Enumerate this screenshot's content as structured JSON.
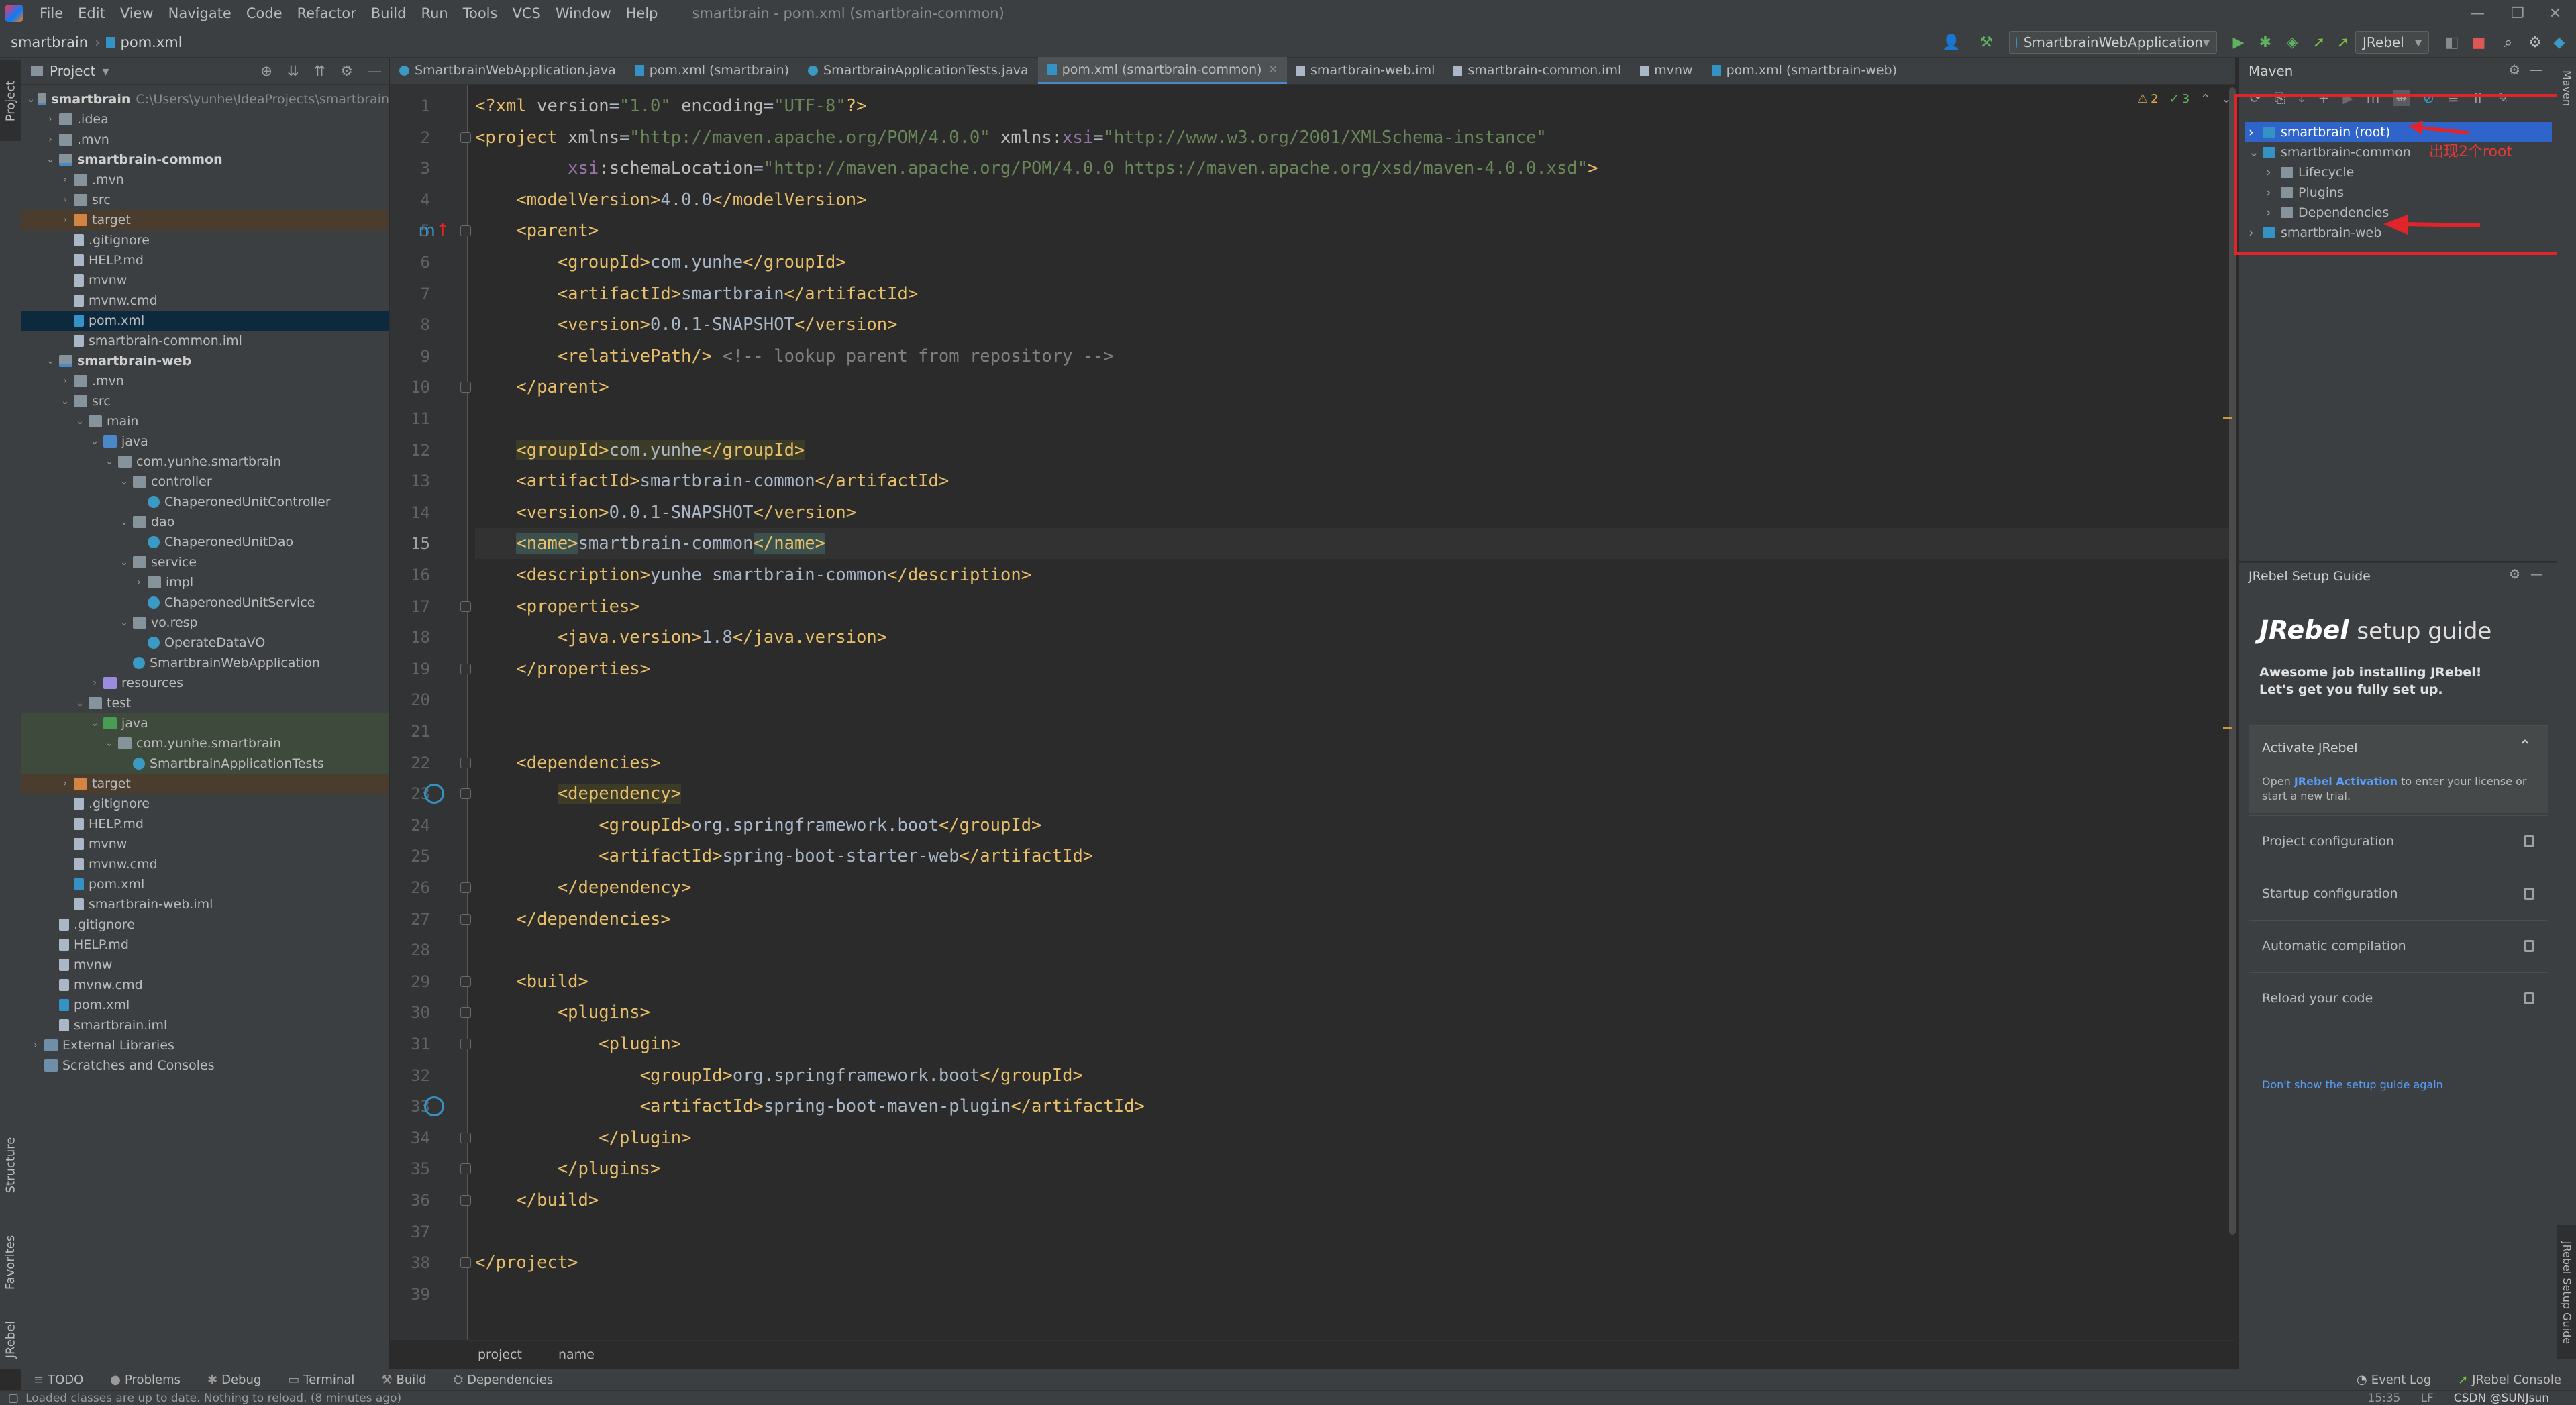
{
  "menu": {
    "items": [
      "File",
      "Edit",
      "View",
      "Navigate",
      "Code",
      "Refactor",
      "Build",
      "Run",
      "Tools",
      "VCS",
      "Window",
      "Help"
    ],
    "window_title": "smartbrain - pom.xml (smartbrain-common)"
  },
  "navbar": {
    "project": "smartbrain",
    "file": "pom.xml",
    "run_config": "SmartbrainWebApplication",
    "jrebel_label": "JRebel"
  },
  "left_strip": {
    "project": "Project",
    "structure": "Structure",
    "favorites": "Favorites",
    "jrebel": "JRebel"
  },
  "project_panel": {
    "title": "Project",
    "tree": [
      {
        "label": "smartbrain",
        "sub": "C:\\Users\\yunhe\\IdeaProjects\\smartbrain",
        "depth": 0,
        "arrow": "v",
        "icon": "folder-module",
        "style": "bold"
      },
      {
        "label": ".idea",
        "depth": 1,
        "arrow": ">",
        "icon": "folder"
      },
      {
        "label": ".mvn",
        "depth": 1,
        "arrow": ">",
        "icon": "folder"
      },
      {
        "label": "smartbrain-common",
        "depth": 1,
        "arrow": "v",
        "icon": "folder-module",
        "style": "bold"
      },
      {
        "label": ".mvn",
        "depth": 2,
        "arrow": ">",
        "icon": "folder"
      },
      {
        "label": "src",
        "depth": 2,
        "arrow": ">",
        "icon": "folder"
      },
      {
        "label": "target",
        "depth": 2,
        "arrow": ">",
        "icon": "folder-excl",
        "style": "excluded"
      },
      {
        "label": ".gitignore",
        "depth": 2,
        "arrow": "",
        "icon": "file"
      },
      {
        "label": "HELP.md",
        "depth": 2,
        "arrow": "",
        "icon": "file"
      },
      {
        "label": "mvnw",
        "depth": 2,
        "arrow": "",
        "icon": "file"
      },
      {
        "label": "mvnw.cmd",
        "depth": 2,
        "arrow": "",
        "icon": "file"
      },
      {
        "label": "pom.xml",
        "depth": 2,
        "arrow": "",
        "icon": "file-m",
        "style": "selected"
      },
      {
        "label": "smartbrain-common.iml",
        "depth": 2,
        "arrow": "",
        "icon": "file"
      },
      {
        "label": "smartbrain-web",
        "depth": 1,
        "arrow": "v",
        "icon": "folder-module",
        "style": "bold"
      },
      {
        "label": ".mvn",
        "depth": 2,
        "arrow": ">",
        "icon": "folder"
      },
      {
        "label": "src",
        "depth": 2,
        "arrow": "v",
        "icon": "folder"
      },
      {
        "label": "main",
        "depth": 3,
        "arrow": "v",
        "icon": "folder"
      },
      {
        "label": "java",
        "depth": 4,
        "arrow": "v",
        "icon": "folder-src"
      },
      {
        "label": "com.yunhe.smartbrain",
        "depth": 5,
        "arrow": "v",
        "icon": "folder"
      },
      {
        "label": "controller",
        "depth": 6,
        "arrow": "v",
        "icon": "folder"
      },
      {
        "label": "ChaperonedUnitController",
        "depth": 7,
        "arrow": "",
        "icon": "class"
      },
      {
        "label": "dao",
        "depth": 6,
        "arrow": "v",
        "icon": "folder"
      },
      {
        "label": "ChaperonedUnitDao",
        "depth": 7,
        "arrow": "",
        "icon": "class"
      },
      {
        "label": "service",
        "depth": 6,
        "arrow": "v",
        "icon": "folder"
      },
      {
        "label": "impl",
        "depth": 7,
        "arrow": ">",
        "icon": "folder"
      },
      {
        "label": "ChaperonedUnitService",
        "depth": 7,
        "arrow": "",
        "icon": "class"
      },
      {
        "label": "vo.resp",
        "depth": 6,
        "arrow": "v",
        "icon": "folder"
      },
      {
        "label": "OperateDataVO",
        "depth": 7,
        "arrow": "",
        "icon": "class"
      },
      {
        "label": "SmartbrainWebApplication",
        "depth": 6,
        "arrow": "",
        "icon": "class"
      },
      {
        "label": "resources",
        "depth": 4,
        "arrow": ">",
        "icon": "folder-res"
      },
      {
        "label": "test",
        "depth": 3,
        "arrow": "v",
        "icon": "folder"
      },
      {
        "label": "java",
        "depth": 4,
        "arrow": "v",
        "icon": "folder-test",
        "style": "testbg"
      },
      {
        "label": "com.yunhe.smartbrain",
        "depth": 5,
        "arrow": "v",
        "icon": "folder",
        "style": "testbg"
      },
      {
        "label": "SmartbrainApplicationTests",
        "depth": 6,
        "arrow": "",
        "icon": "class",
        "style": "testbg"
      },
      {
        "label": "target",
        "depth": 2,
        "arrow": ">",
        "icon": "folder-excl",
        "style": "excluded"
      },
      {
        "label": ".gitignore",
        "depth": 2,
        "arrow": "",
        "icon": "file"
      },
      {
        "label": "HELP.md",
        "depth": 2,
        "arrow": "",
        "icon": "file"
      },
      {
        "label": "mvnw",
        "depth": 2,
        "arrow": "",
        "icon": "file"
      },
      {
        "label": "mvnw.cmd",
        "depth": 2,
        "arrow": "",
        "icon": "file"
      },
      {
        "label": "pom.xml",
        "depth": 2,
        "arrow": "",
        "icon": "file-m"
      },
      {
        "label": "smartbrain-web.iml",
        "depth": 2,
        "arrow": "",
        "icon": "file"
      },
      {
        "label": ".gitignore",
        "depth": 1,
        "arrow": "",
        "icon": "file"
      },
      {
        "label": "HELP.md",
        "depth": 1,
        "arrow": "",
        "icon": "file"
      },
      {
        "label": "mvnw",
        "depth": 1,
        "arrow": "",
        "icon": "file"
      },
      {
        "label": "mvnw.cmd",
        "depth": 1,
        "arrow": "",
        "icon": "file"
      },
      {
        "label": "pom.xml",
        "depth": 1,
        "arrow": "",
        "icon": "file-m"
      },
      {
        "label": "smartbrain.iml",
        "depth": 1,
        "arrow": "",
        "icon": "file"
      },
      {
        "label": "External Libraries",
        "depth": 0,
        "arrow": ">",
        "icon": "lib"
      },
      {
        "label": "Scratches and Consoles",
        "depth": 0,
        "arrow": "",
        "icon": "lib"
      }
    ]
  },
  "editor": {
    "tabs": [
      {
        "label": "SmartbrainWebApplication.java",
        "icon": "class",
        "active": false
      },
      {
        "label": "pom.xml (smartbrain)",
        "icon": "maven",
        "active": false
      },
      {
        "label": "SmartbrainApplicationTests.java",
        "icon": "class",
        "active": false
      },
      {
        "label": "pom.xml (smartbrain-common)",
        "icon": "maven",
        "active": true
      },
      {
        "label": "smartbrain-web.iml",
        "icon": "file",
        "active": false
      },
      {
        "label": "smartbrain-common.iml",
        "icon": "file",
        "active": false
      },
      {
        "label": "mvnw",
        "icon": "file",
        "active": false
      },
      {
        "label": "pom.xml (smartbrain-web)",
        "icon": "maven",
        "active": false
      }
    ],
    "inspection": {
      "warnings": "2",
      "ok": "3"
    },
    "current_line": 15,
    "lines": [
      [
        [
          "t-tag",
          "<?xml "
        ],
        [
          "t-attr",
          "version"
        ],
        [
          "t-text",
          "="
        ],
        [
          "t-str",
          "\"1.0\""
        ],
        [
          "t-text",
          " "
        ],
        [
          "t-attr",
          "encoding"
        ],
        [
          "t-text",
          "="
        ],
        [
          "t-str",
          "\"UTF-8\""
        ],
        [
          "t-tag",
          "?>"
        ]
      ],
      [
        [
          "t-tag",
          "<project "
        ],
        [
          "t-attr",
          "xmlns"
        ],
        [
          "t-text",
          "="
        ],
        [
          "t-str",
          "\"http://maven.apache.org/POM/4.0.0\""
        ],
        [
          "t-text",
          " "
        ],
        [
          "t-attr",
          "xmlns:"
        ],
        [
          "t-ns",
          "xsi"
        ],
        [
          "t-text",
          "="
        ],
        [
          "t-str",
          "\"http://www.w3.org/2001/XMLSchema-instance\""
        ]
      ],
      [
        [
          "t-text",
          "         "
        ],
        [
          "t-ns",
          "xsi"
        ],
        [
          "t-attr",
          ":schemaLocation"
        ],
        [
          "t-text",
          "="
        ],
        [
          "t-str",
          "\"http://maven.apache.org/POM/4.0.0 https://maven.apache.org/xsd/maven-4.0.0.xsd\""
        ],
        [
          "t-tag",
          ">"
        ]
      ],
      [
        [
          "t-text",
          "    "
        ],
        [
          "t-tag",
          "<modelVersion>"
        ],
        [
          "t-text",
          "4.0.0"
        ],
        [
          "t-tag",
          "</modelVersion>"
        ]
      ],
      [
        [
          "t-text",
          "    "
        ],
        [
          "t-tag",
          "<parent>"
        ]
      ],
      [
        [
          "t-text",
          "        "
        ],
        [
          "t-tag",
          "<groupId>"
        ],
        [
          "t-text",
          "com.yunhe"
        ],
        [
          "t-tag",
          "</groupId>"
        ]
      ],
      [
        [
          "t-text",
          "        "
        ],
        [
          "t-tag",
          "<artifactId>"
        ],
        [
          "t-text",
          "smartbrain"
        ],
        [
          "t-tag",
          "</artifactId>"
        ]
      ],
      [
        [
          "t-text",
          "        "
        ],
        [
          "t-tag",
          "<version>"
        ],
        [
          "t-text",
          "0.0.1-SNAPSHOT"
        ],
        [
          "t-tag",
          "</version>"
        ]
      ],
      [
        [
          "t-text",
          "        "
        ],
        [
          "t-tag",
          "<relativePath/>"
        ],
        [
          "t-text",
          " "
        ],
        [
          "t-com",
          "<!-- lookup parent from repository -->"
        ]
      ],
      [
        [
          "t-text",
          "    "
        ],
        [
          "t-tag",
          "</parent>"
        ]
      ],
      [
        [
          "t-text",
          ""
        ]
      ],
      [
        [
          "t-text",
          "    "
        ],
        [
          "t-tag t-hl",
          "<groupId>"
        ],
        [
          "t-text t-hl",
          "com.yunhe"
        ],
        [
          "t-tag t-hl",
          "</groupId>"
        ]
      ],
      [
        [
          "t-text",
          "    "
        ],
        [
          "t-tag",
          "<artifactId>"
        ],
        [
          "t-text",
          "smartbrain-common"
        ],
        [
          "t-tag",
          "</artifactId>"
        ]
      ],
      [
        [
          "t-text",
          "    "
        ],
        [
          "t-tag",
          "<version>"
        ],
        [
          "t-text",
          "0.0.1-SNAPSHOT"
        ],
        [
          "t-tag",
          "</version>"
        ]
      ],
      [
        [
          "t-text",
          "    "
        ],
        [
          "t-tag t-hl2",
          "<name>"
        ],
        [
          "t-text",
          "smartbrain-common"
        ],
        [
          "t-tag t-hl2",
          "</name>"
        ]
      ],
      [
        [
          "t-text",
          "    "
        ],
        [
          "t-tag",
          "<description>"
        ],
        [
          "t-text",
          "yunhe smartbrain-common"
        ],
        [
          "t-tag",
          "</description>"
        ]
      ],
      [
        [
          "t-text",
          "    "
        ],
        [
          "t-tag",
          "<properties>"
        ]
      ],
      [
        [
          "t-text",
          "        "
        ],
        [
          "t-tag",
          "<java.version>"
        ],
        [
          "t-text",
          "1.8"
        ],
        [
          "t-tag",
          "</java.version>"
        ]
      ],
      [
        [
          "t-text",
          "    "
        ],
        [
          "t-tag",
          "</properties>"
        ]
      ],
      [
        [
          "t-text",
          ""
        ]
      ],
      [
        [
          "t-text",
          ""
        ]
      ],
      [
        [
          "t-text",
          "    "
        ],
        [
          "t-tag",
          "<dependencies>"
        ]
      ],
      [
        [
          "t-text",
          "        "
        ],
        [
          "t-tag t-hl",
          "<dependency>"
        ]
      ],
      [
        [
          "t-text",
          "            "
        ],
        [
          "t-tag",
          "<groupId>"
        ],
        [
          "t-text",
          "org.springframework.boot"
        ],
        [
          "t-tag",
          "</groupId>"
        ]
      ],
      [
        [
          "t-text",
          "            "
        ],
        [
          "t-tag",
          "<artifactId>"
        ],
        [
          "t-text",
          "spring-boot-starter-web"
        ],
        [
          "t-tag",
          "</artifactId>"
        ]
      ],
      [
        [
          "t-text",
          "        "
        ],
        [
          "t-tag",
          "</dependency>"
        ]
      ],
      [
        [
          "t-text",
          "    "
        ],
        [
          "t-tag",
          "</dependencies>"
        ]
      ],
      [
        [
          "t-text",
          ""
        ]
      ],
      [
        [
          "t-text",
          "    "
        ],
        [
          "t-tag",
          "<build>"
        ]
      ],
      [
        [
          "t-text",
          "        "
        ],
        [
          "t-tag",
          "<plugins>"
        ]
      ],
      [
        [
          "t-text",
          "            "
        ],
        [
          "t-tag",
          "<plugin>"
        ]
      ],
      [
        [
          "t-text",
          "                "
        ],
        [
          "t-tag",
          "<groupId>"
        ],
        [
          "t-text",
          "org.springframework.boot"
        ],
        [
          "t-tag",
          "</groupId>"
        ]
      ],
      [
        [
          "t-text",
          "                "
        ],
        [
          "t-tag",
          "<artifactId>"
        ],
        [
          "t-text",
          "spring-boot-maven-plugin"
        ],
        [
          "t-tag",
          "</artifactId>"
        ]
      ],
      [
        [
          "t-text",
          "            "
        ],
        [
          "t-tag",
          "</plugin>"
        ]
      ],
      [
        [
          "t-text",
          "        "
        ],
        [
          "t-tag",
          "</plugins>"
        ]
      ],
      [
        [
          "t-text",
          "    "
        ],
        [
          "t-tag",
          "</build>"
        ]
      ],
      [
        [
          "t-text",
          ""
        ]
      ],
      [
        [
          "t-tag",
          "</project>"
        ]
      ],
      [
        [
          "t-text",
          ""
        ]
      ]
    ],
    "breadcrumb": [
      "project",
      "name"
    ]
  },
  "maven": {
    "title": "Maven",
    "tree": [
      {
        "label": "smartbrain (root)",
        "depth": 0,
        "arrow": ">",
        "selected": true
      },
      {
        "label": "smartbrain-common",
        "depth": 0,
        "arrow": "v",
        "selected": false
      },
      {
        "label": "Lifecycle",
        "depth": 1,
        "arrow": ">",
        "selected": false
      },
      {
        "label": "Plugins",
        "depth": 1,
        "arrow": ">",
        "selected": false
      },
      {
        "label": "Dependencies",
        "depth": 1,
        "arrow": ">",
        "selected": false
      },
      {
        "label": "smartbrain-web",
        "depth": 0,
        "arrow": ">",
        "selected": false
      }
    ],
    "annotation": "出现2个root"
  },
  "jrebel": {
    "header": "JRebel Setup Guide",
    "logo": "JRebel",
    "title": "setup guide",
    "intro_line1": "Awesome job installing JRebel!",
    "intro_line2": "Let's get you fully set up.",
    "activate_title": "Activate JRebel",
    "activate_pre": "Open ",
    "activate_link": "JRebel Activation",
    "activate_post": " to enter your license or",
    "activate_post2": "start a new trial.",
    "sections": [
      "Project configuration",
      "Startup configuration",
      "Automatic compilation",
      "Reload your code"
    ],
    "dont_show": "Don't show the setup guide again"
  },
  "right_strip": {
    "jrebel_guide": "JRebel Setup Guide",
    "maven": "Maven"
  },
  "bottom_tools": [
    "TODO",
    "Problems",
    "Debug",
    "Terminal",
    "Build",
    "Dependencies"
  ],
  "bottom_right": [
    "Event Log",
    "JRebel Console"
  ],
  "status": {
    "message": "Loaded classes are up to date. Nothing to reload. (8 minutes ago)",
    "position": "15:35",
    "line_sep": "LF",
    "watermark": "CSDN @SUNJsun"
  },
  "colors": {
    "accent": "#4a88c7",
    "annotation": "#e0242a",
    "selected": "#2f65ca"
  }
}
